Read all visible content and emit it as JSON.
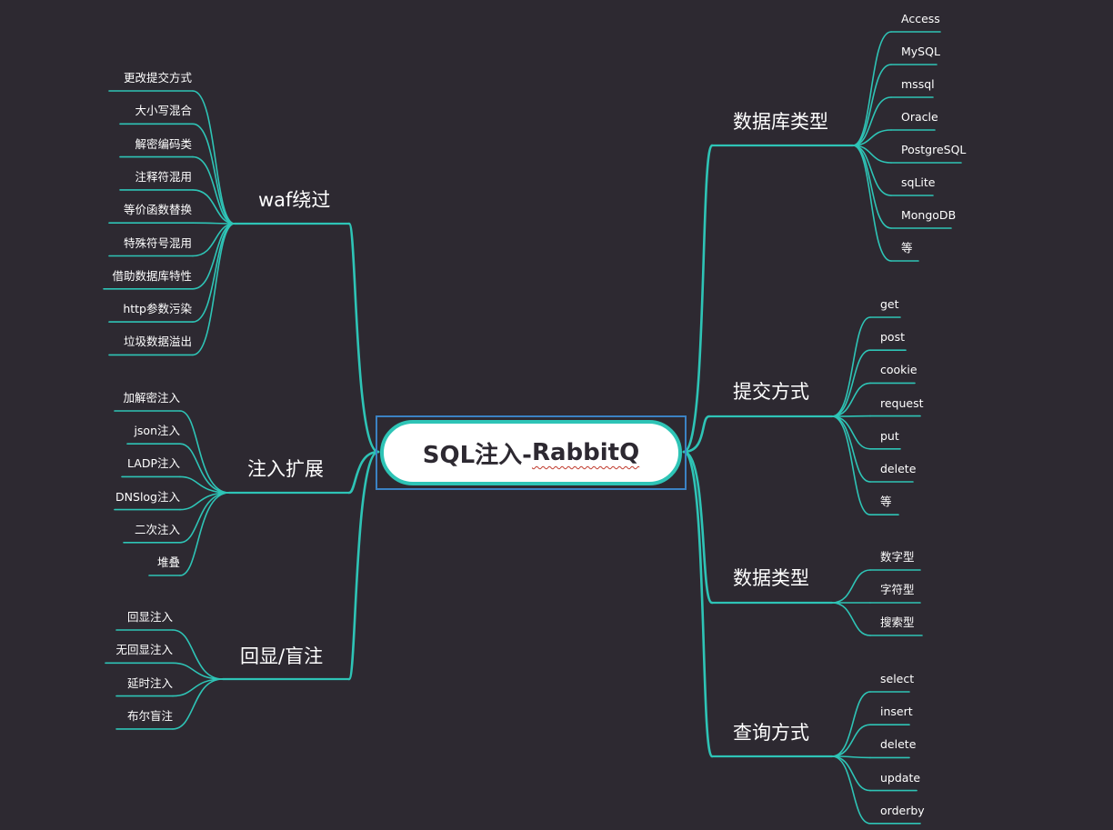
{
  "center": {
    "prefix": "SQL注入-",
    "suffix": "RabbitQ"
  },
  "branches": {
    "waf": {
      "label": "waf绕过",
      "items": [
        "更改提交方式",
        "大小写混合",
        "解密编码类",
        "注释符混用",
        "等价函数替换",
        "特殊符号混用",
        "借助数据库特性",
        "http参数污染",
        "垃圾数据溢出"
      ]
    },
    "injext": {
      "label": "注入扩展",
      "items": [
        "加解密注入",
        "json注入",
        "LADP注入",
        "DNSlog注入",
        "二次注入",
        "堆叠"
      ]
    },
    "echo": {
      "label": "回显/盲注",
      "items": [
        "回显注入",
        "无回显注入",
        "延时注入",
        "布尔盲注"
      ]
    },
    "dbtype": {
      "label": "数据库类型",
      "items": [
        "Access",
        "MySQL",
        "mssql",
        "Oracle",
        "PostgreSQL",
        "sqLite",
        "MongoDB",
        "等"
      ]
    },
    "submit": {
      "label": "提交方式",
      "items": [
        "get",
        "post",
        "cookie",
        "request",
        "put",
        "delete",
        "等"
      ]
    },
    "datatype": {
      "label": "数据类型",
      "items": [
        "数字型",
        "字符型",
        "搜索型"
      ]
    },
    "query": {
      "label": "查询方式",
      "items": [
        "select",
        "insert",
        "delete",
        "update",
        "orderby"
      ]
    }
  },
  "colors": {
    "background": "#2d2931",
    "link": "#2ec4b6",
    "center_fill": "#ffffff",
    "selection": "#3b82c4"
  }
}
